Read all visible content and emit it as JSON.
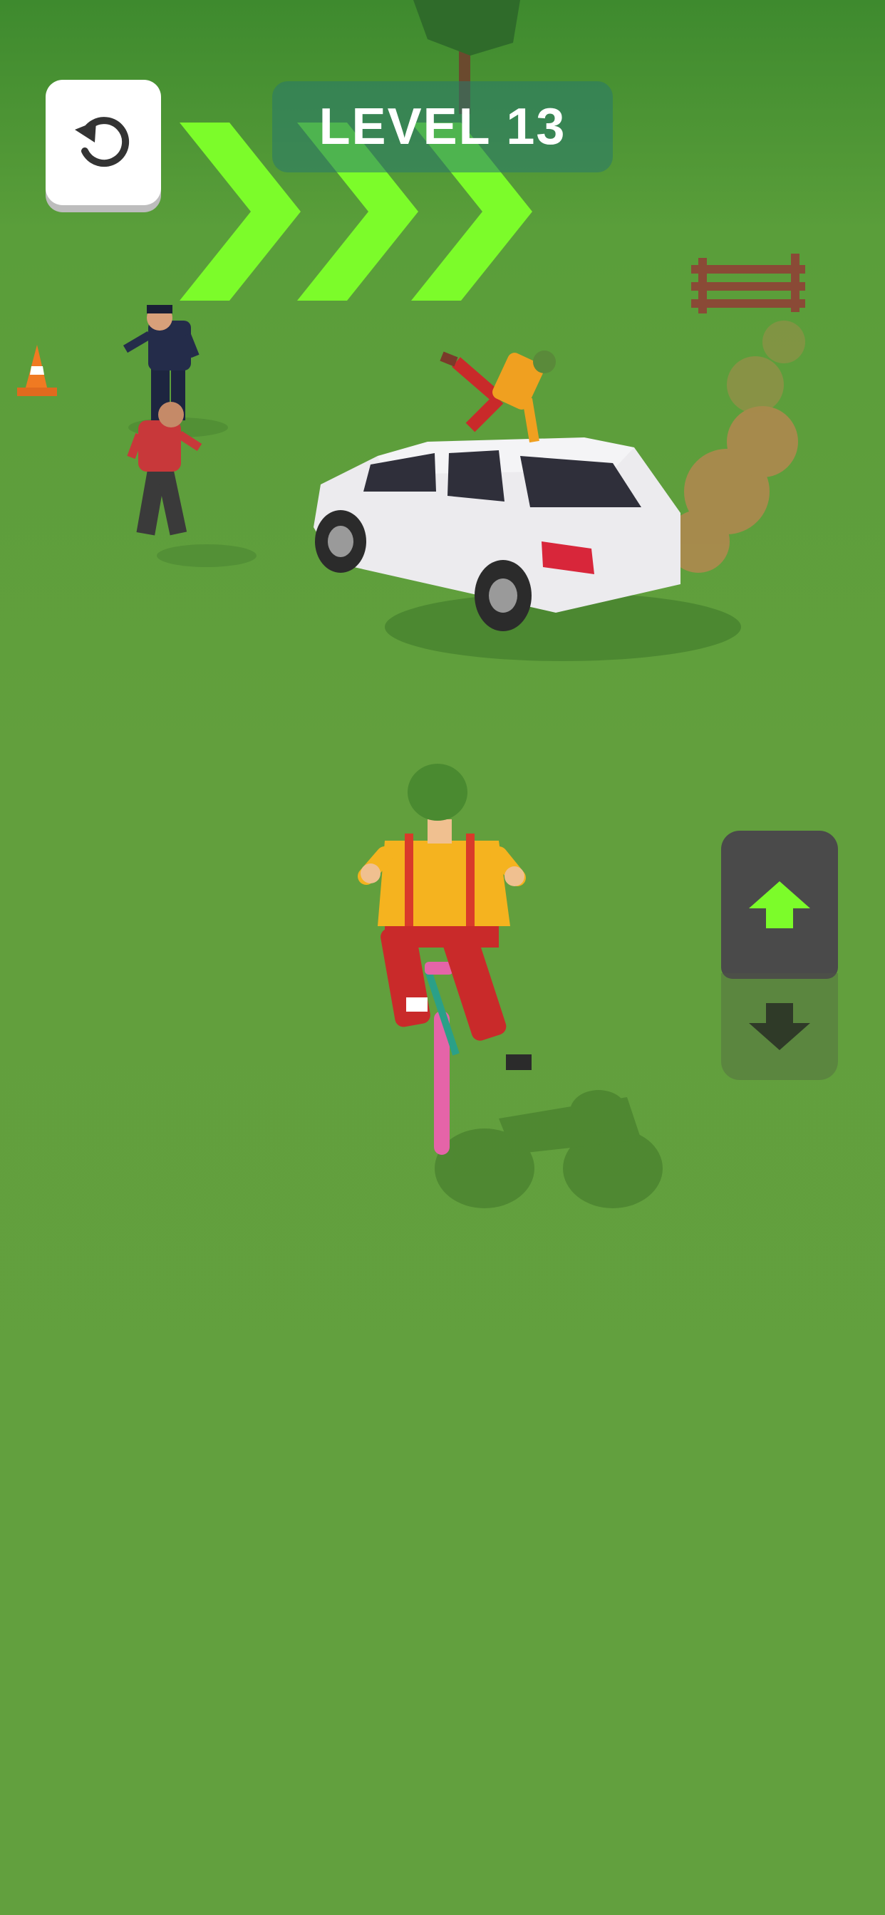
{
  "hud": {
    "level_label": "LEVEL 13",
    "restart_icon": "restart-icon",
    "progress_icon": "chevron-right-icon"
  },
  "controls": {
    "up_icon": "arrow-up-icon",
    "down_icon": "arrow-down-icon"
  },
  "colors": {
    "grass": "#62a03e",
    "chevron": "#7cfc2a",
    "level_pill": "#28786e",
    "control_dark": "#4a4a4a",
    "arrow_up": "#7cfc2a",
    "arrow_down": "#2f3a28"
  }
}
